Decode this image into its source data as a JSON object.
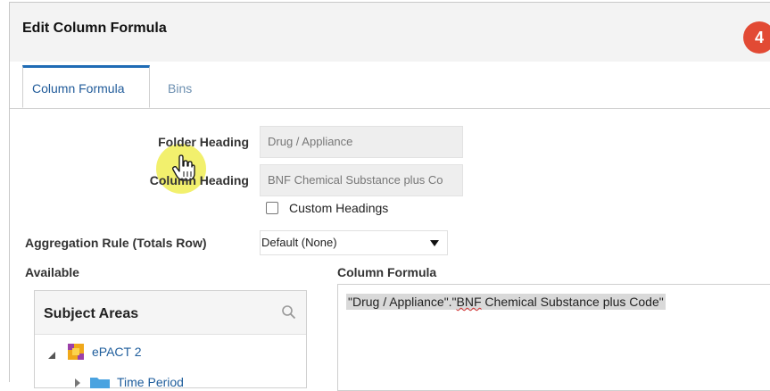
{
  "dialog": {
    "title": "Edit Column Formula",
    "step_badge": "4"
  },
  "tabs": [
    {
      "label": "Column Formula",
      "active": true
    },
    {
      "label": "Bins",
      "active": false
    }
  ],
  "form": {
    "folder_heading_label": "Folder Heading",
    "folder_heading_value": "Drug / Appliance",
    "column_heading_label": "Column Heading",
    "column_heading_value": "BNF Chemical Substance plus Co",
    "custom_headings_label": "Custom Headings",
    "custom_headings_checked": false,
    "aggregation_label": "Aggregation Rule (Totals Row)",
    "aggregation_value": "Default (None)"
  },
  "available": {
    "label": "Available",
    "panel_title": "Subject Areas",
    "tree": [
      {
        "label": "ePACT 2",
        "expanded": true,
        "icon": "subject-area-icon"
      },
      {
        "label": "Time Period",
        "expanded": false,
        "icon": "folder-icon"
      }
    ]
  },
  "formula": {
    "label": "Column Formula",
    "part1": "\"Drug / Appliance\".\"",
    "part2": "BNF",
    "part3": " Chemical Substance plus Code\""
  },
  "colors": {
    "badge": "#e24a34",
    "tab_accent": "#1f6bb5",
    "cursor_highlight": "#eeeb3c",
    "link": "#1e5d9c"
  }
}
